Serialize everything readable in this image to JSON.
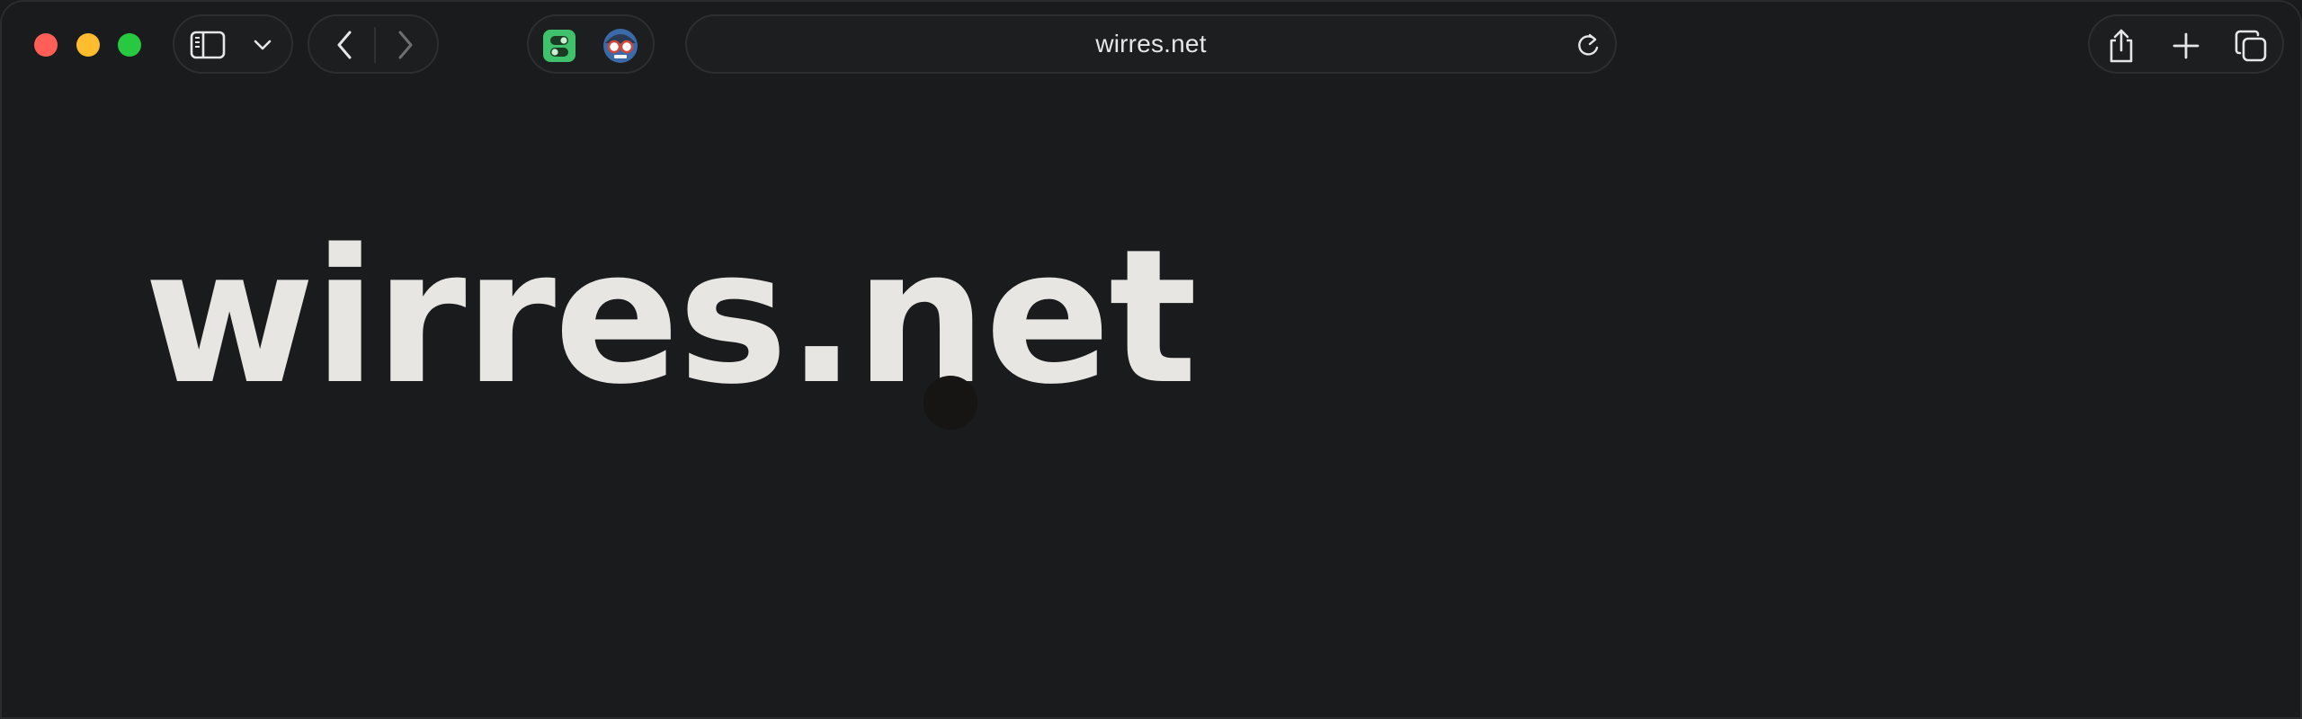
{
  "window": {
    "traffic_lights": {
      "close_color": "#ff5f57",
      "minimize_color": "#febc2e",
      "maximize_color": "#28c840"
    }
  },
  "toolbar": {
    "sidebar_icon": "sidebar-icon",
    "sidebar_menu_icon": "chevron-down-icon",
    "back_icon": "chevron-left-icon",
    "forward_icon": "chevron-right-icon",
    "extensions": [
      {
        "name": "toggle-switch-extension-icon",
        "color": "#3fc26b"
      },
      {
        "name": "spy-glasses-extension-icon",
        "color": "#3b6aa8"
      }
    ],
    "address": {
      "text": "wirres.net",
      "reload_icon": "reload-icon"
    },
    "share_icon": "share-icon",
    "new_tab_icon": "plus-icon",
    "tabs_overview_icon": "tabs-overview-icon"
  },
  "page": {
    "logo_text": "wirres.net",
    "background_color": "#191b1c",
    "text_color": "#e8e6e2"
  }
}
